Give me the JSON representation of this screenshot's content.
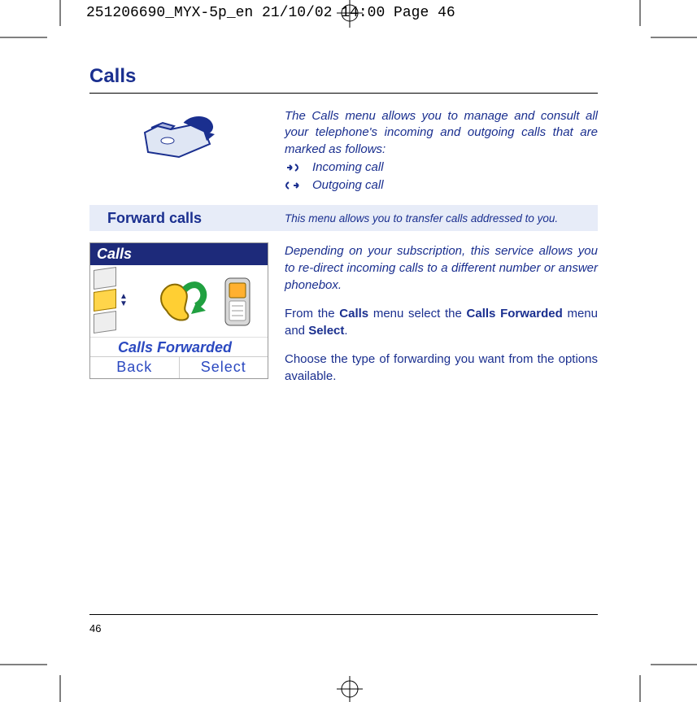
{
  "printer_slug": "251206690_MYX-5p_en  21/10/02  14:00  Page 46",
  "title": "Calls",
  "intro": {
    "para": "The Calls menu allows you to manage and consult all your tele­phone's incoming and outgoing calls that are marked as follows:",
    "incoming_label": "Incoming call",
    "outgoing_label": "Outgoing call"
  },
  "subsection": {
    "heading": "Forward calls",
    "blurb": "This menu allows you to transfer calls addressed to you."
  },
  "body": {
    "p1": "Depending on your subscription, this service allows you to re-direct incom­ing calls to a different number or answer phonebox.",
    "p2_pre": "From the ",
    "p2_b1": "Calls",
    "p2_mid": " menu select the ",
    "p2_b2": "Calls Forwarded",
    "p2_mid2": " menu and ",
    "p2_b3": "Select",
    "p2_post": ".",
    "p3": "Choose the type of forwarding you want from the options available."
  },
  "screenshot": {
    "title": "Calls",
    "active_label": "Calls Forwarded",
    "soft_left": "Back",
    "soft_right": "Select"
  },
  "page_number": "46"
}
